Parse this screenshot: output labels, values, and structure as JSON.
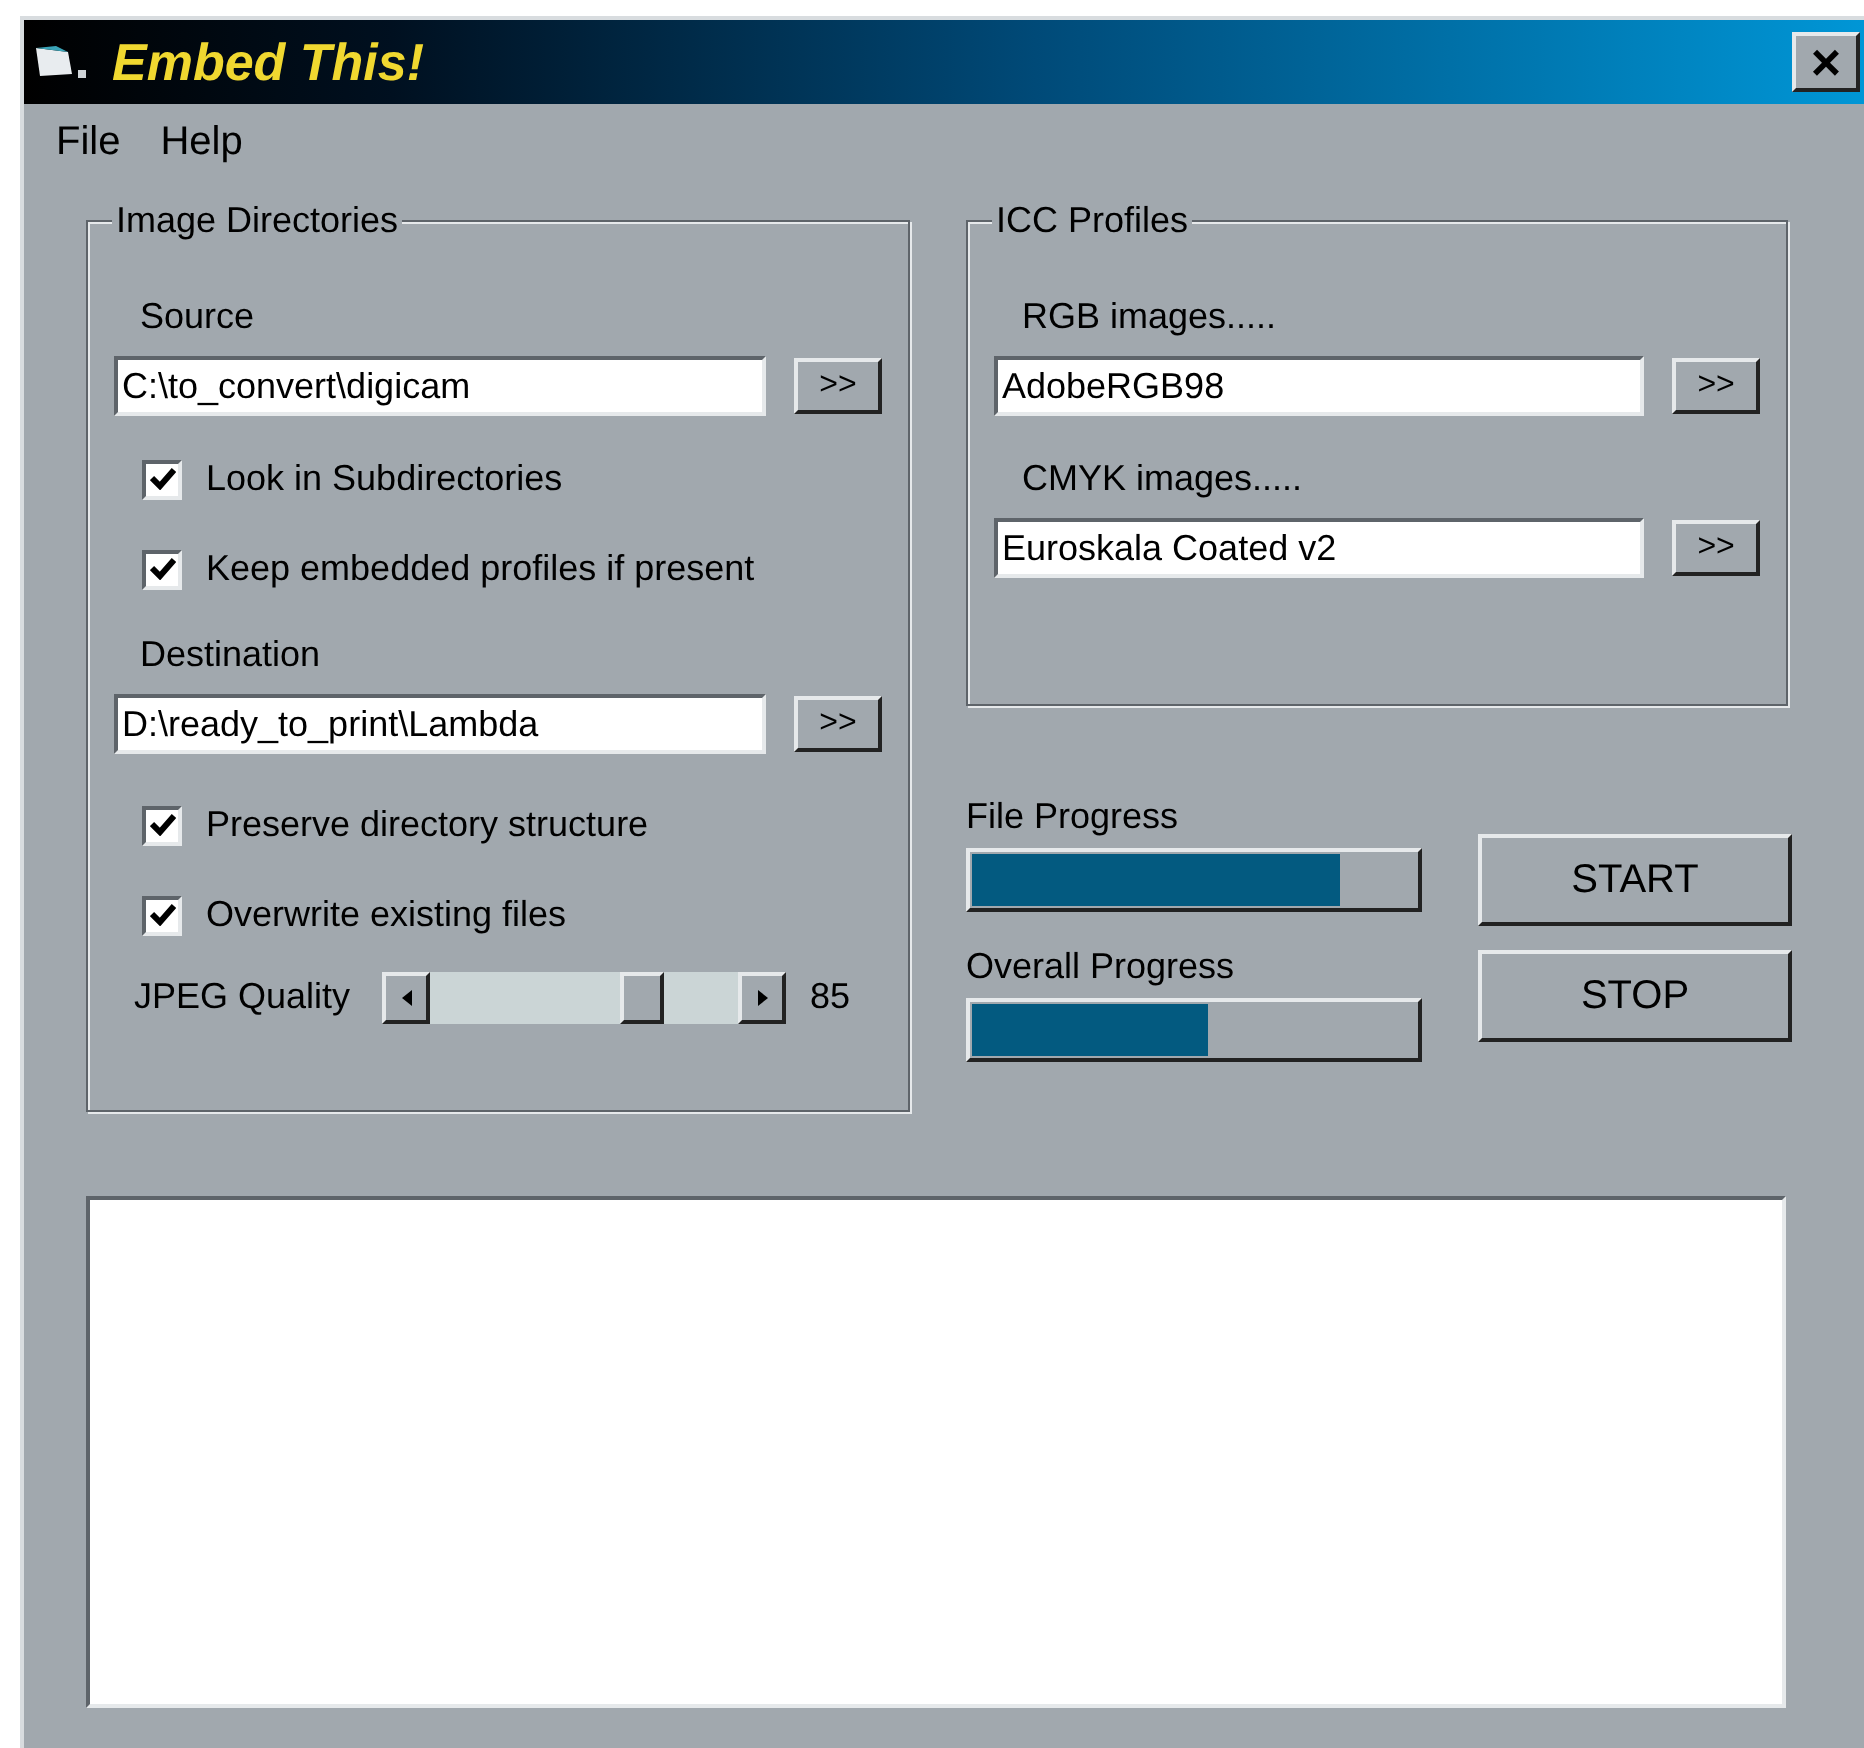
{
  "window": {
    "title": "Embed This!",
    "close": "×"
  },
  "menu": [
    {
      "label": "File"
    },
    {
      "label": "Help"
    }
  ],
  "image_directories": {
    "title": "Image Directories",
    "source": {
      "label": "Source",
      "value": "C:\\to_convert\\digicam",
      "browse": ">>"
    },
    "source_options": [
      {
        "label": "Look in Subdirectories",
        "checked": true
      },
      {
        "label": "Keep embedded profiles if present",
        "checked": true
      }
    ],
    "destination": {
      "label": "Destination",
      "value": "D:\\ready_to_print\\Lambda",
      "browse": ">>"
    },
    "destination_options": [
      {
        "label": "Preserve directory structure",
        "checked": true
      },
      {
        "label": "Overwrite existing files",
        "checked": true
      }
    ],
    "jpeg_quality": {
      "label": "JPEG Quality",
      "level": 0.72,
      "reading": "85"
    }
  },
  "icc_profiles": {
    "title": "ICC Profiles",
    "fields": [
      {
        "label": "RGB images.....",
        "value": "AdobeRGB98",
        "browse": ">>"
      },
      {
        "label": "CMYK images.....",
        "value": "Euroskala Coated v2",
        "browse": ">>"
      }
    ]
  },
  "progress": [
    {
      "label": "File Progress",
      "level": 0.83
    },
    {
      "label": "Overall Progress",
      "level": 0.53
    }
  ],
  "buttons": [
    {
      "label": "START"
    },
    {
      "label": "STOP"
    }
  ]
}
